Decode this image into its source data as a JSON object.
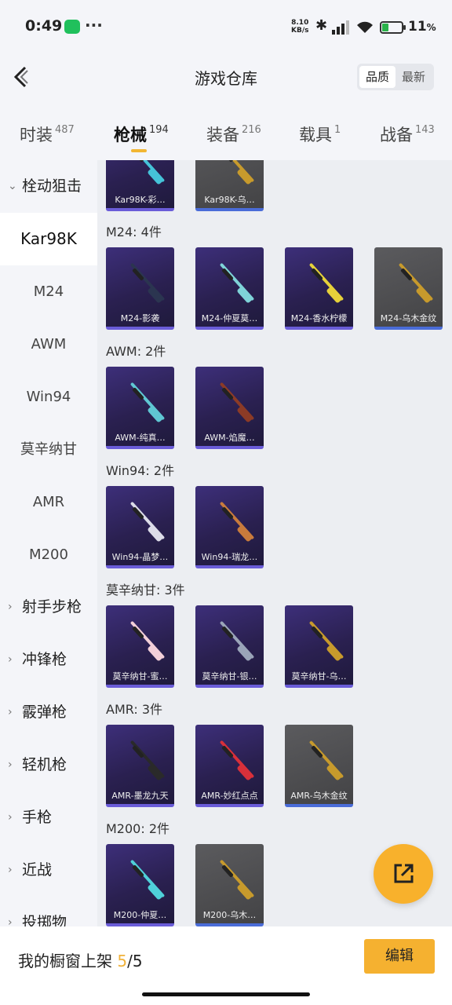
{
  "status_bar": {
    "time": "0:49",
    "more": "···",
    "net_speed": "8.10",
    "net_unit": "KB/s",
    "battery": "11",
    "battery_unit": "%"
  },
  "header": {
    "title": "游戏仓库",
    "sort_options": [
      "品质",
      "最新"
    ],
    "sort_selected": "品质"
  },
  "tabs": [
    {
      "label": "时装",
      "count": "487"
    },
    {
      "label": "枪械",
      "count": "194",
      "active": true
    },
    {
      "label": "装备",
      "count": "216"
    },
    {
      "label": "载具",
      "count": "1"
    },
    {
      "label": "战备",
      "count": "143"
    }
  ],
  "sidebar": {
    "items": [
      {
        "label": "栓动狙击",
        "type": "group",
        "expanded": true
      },
      {
        "label": "Kar98K",
        "type": "sub",
        "active": true
      },
      {
        "label": "M24",
        "type": "sub"
      },
      {
        "label": "AWM",
        "type": "sub"
      },
      {
        "label": "Win94",
        "type": "sub"
      },
      {
        "label": "莫辛纳甘",
        "type": "sub"
      },
      {
        "label": "AMR",
        "type": "sub"
      },
      {
        "label": "M200",
        "type": "sub"
      },
      {
        "label": "射手步枪",
        "type": "group"
      },
      {
        "label": "冲锋枪",
        "type": "group"
      },
      {
        "label": "霰弹枪",
        "type": "group"
      },
      {
        "label": "轻机枪",
        "type": "group"
      },
      {
        "label": "手枪",
        "type": "group"
      },
      {
        "label": "近战",
        "type": "group"
      },
      {
        "label": "投掷物",
        "type": "group"
      }
    ]
  },
  "content": {
    "top_cards": [
      {
        "name": "Kar98K-彩…",
        "style": "purple",
        "color": "#45c3d8"
      },
      {
        "name": "Kar98K-乌…",
        "style": "grey",
        "color": "#c79a2c"
      }
    ],
    "sections": [
      {
        "title": "M24: 4件",
        "items": [
          {
            "name": "M24-影袭",
            "style": "purple",
            "color": "#2b3550"
          },
          {
            "name": "M24-仲夏莫…",
            "style": "purple",
            "color": "#7fd3d8"
          },
          {
            "name": "M24-香水柠檬",
            "style": "purple",
            "color": "#e6d13a"
          },
          {
            "name": "M24-乌木金纹",
            "style": "grey",
            "color": "#c79a2c"
          }
        ]
      },
      {
        "title": "AWM: 2件",
        "items": [
          {
            "name": "AWM-纯真…",
            "style": "purple",
            "color": "#5fc7d3"
          },
          {
            "name": "AWM-焰魔…",
            "style": "purple",
            "color": "#8c3b26"
          }
        ]
      },
      {
        "title": "Win94: 2件",
        "items": [
          {
            "name": "Win94-晶梦…",
            "style": "purple",
            "color": "#dcdce8"
          },
          {
            "name": "Win94-瑞龙…",
            "style": "purple",
            "color": "#c87b3c"
          }
        ]
      },
      {
        "title": "莫辛纳甘: 3件",
        "items": [
          {
            "name": "莫辛纳甘-蜜…",
            "style": "purple",
            "color": "#f2cfd8"
          },
          {
            "name": "莫辛纳甘-银…",
            "style": "purple",
            "color": "#9aa4b8"
          },
          {
            "name": "莫辛纳甘-乌…",
            "style": "purple",
            "color": "#c79a2c"
          }
        ]
      },
      {
        "title": "AMR: 3件",
        "items": [
          {
            "name": "AMR-墨龙九天",
            "style": "purple",
            "color": "#2a2a2a"
          },
          {
            "name": "AMR-妙红点点",
            "style": "purple",
            "color": "#d8303a"
          },
          {
            "name": "AMR-乌木金纹",
            "style": "grey",
            "color": "#c79a2c"
          }
        ]
      },
      {
        "title": "M200: 2件",
        "items": [
          {
            "name": "M200-仲夏…",
            "style": "purple",
            "color": "#4fd0d8"
          },
          {
            "name": "M200-乌木…",
            "style": "grey",
            "color": "#c79a2c"
          }
        ]
      }
    ]
  },
  "bottom_bar": {
    "label": "我的橱窗上架",
    "current": "5",
    "total": "/5",
    "edit_label": "编辑"
  },
  "icons": {
    "back": "back-arrow-icon",
    "fab": "share-external-icon"
  },
  "colors": {
    "accent": "#f5b130",
    "tab_underline": "#f2b633"
  }
}
